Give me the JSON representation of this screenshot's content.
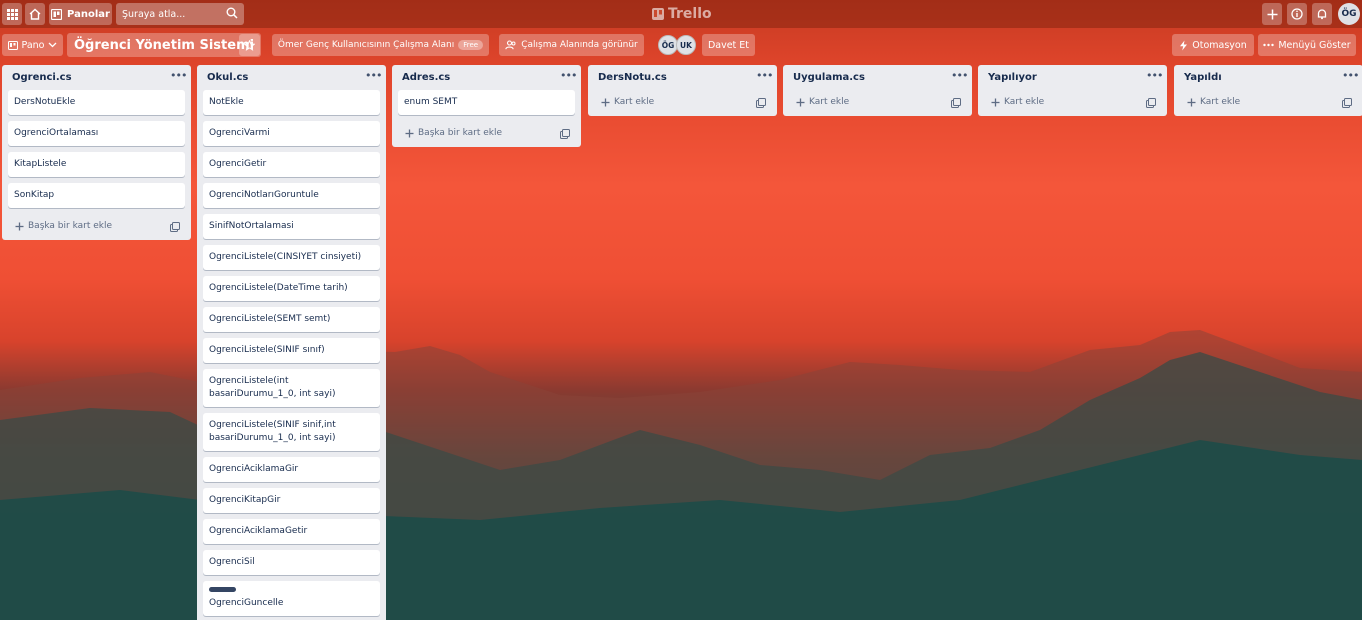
{
  "topbar": {
    "boards_label": "Panolar",
    "search_placeholder": "Şuraya atla...",
    "logo_text": "Trello",
    "user_initials": "ÖG"
  },
  "board_header": {
    "view_label": "Pano",
    "board_title": "Öğrenci Yönetim Sistemi",
    "workspace_label": "Ömer Genç Kullanıcısının Çalışma Alanı",
    "free_badge": "Free",
    "visibility_label": "Çalışma Alanında görünür",
    "members": [
      "ÖG",
      "UK"
    ],
    "invite_label": "Davet Et",
    "automation_label": "Otomasyon",
    "show_menu_label": "Menüyü Göster"
  },
  "lists": [
    {
      "title": "Ogrenci.cs",
      "cards": [
        {
          "text": "DersNotuEkle"
        },
        {
          "text": "OgrenciOrtalaması"
        },
        {
          "text": "KitapListele"
        },
        {
          "text": "SonKitap"
        }
      ],
      "add_label": "Başka bir kart ekle"
    },
    {
      "title": "Okul.cs",
      "cards": [
        {
          "text": "NotEkle"
        },
        {
          "text": "OgrenciVarmi"
        },
        {
          "text": "OgrenciGetir"
        },
        {
          "text": "OgrenciNotlarıGoruntule"
        },
        {
          "text": "SinifNotOrtalamasi"
        },
        {
          "text": "OgrenciListele(CINSIYET cinsiyeti)"
        },
        {
          "text": "OgrenciListele(DateTime tarih)"
        },
        {
          "text": "OgrenciListele(SEMT semt)"
        },
        {
          "text": "OgrenciListele(SINIF sınıf)"
        },
        {
          "text": "OgrenciListele(int basariDurumu_1_0, int sayi)"
        },
        {
          "text": "OgrenciListele(SINIF sinif,int basariDurumu_1_0, int sayi)"
        },
        {
          "text": "OgrenciAciklamaGir"
        },
        {
          "text": "OgrenciKitapGir"
        },
        {
          "text": "OgrenciAciklamaGetir"
        },
        {
          "text": "OgrenciSil"
        },
        {
          "text": "OgrenciGuncelle",
          "label_color": "#344563"
        }
      ],
      "add_label": "Başka bir kart ekle"
    },
    {
      "title": "Adres.cs",
      "cards": [
        {
          "text": "enum SEMT"
        }
      ],
      "add_label": "Başka bir kart ekle"
    },
    {
      "title": "DersNotu.cs",
      "cards": [],
      "add_label": "Kart ekle"
    },
    {
      "title": "Uygulama.cs",
      "cards": [],
      "add_label": "Kart ekle"
    },
    {
      "title": "Yapılıyor",
      "cards": [],
      "add_label": "Kart ekle"
    },
    {
      "title": "Yapıldı",
      "cards": [],
      "add_label": "Kart ekle"
    }
  ],
  "colors": {
    "list_bg": "#ebecf0",
    "card_bg": "#ffffff",
    "sky_accent": "#f4563a",
    "mountain": "#1c4c49"
  }
}
